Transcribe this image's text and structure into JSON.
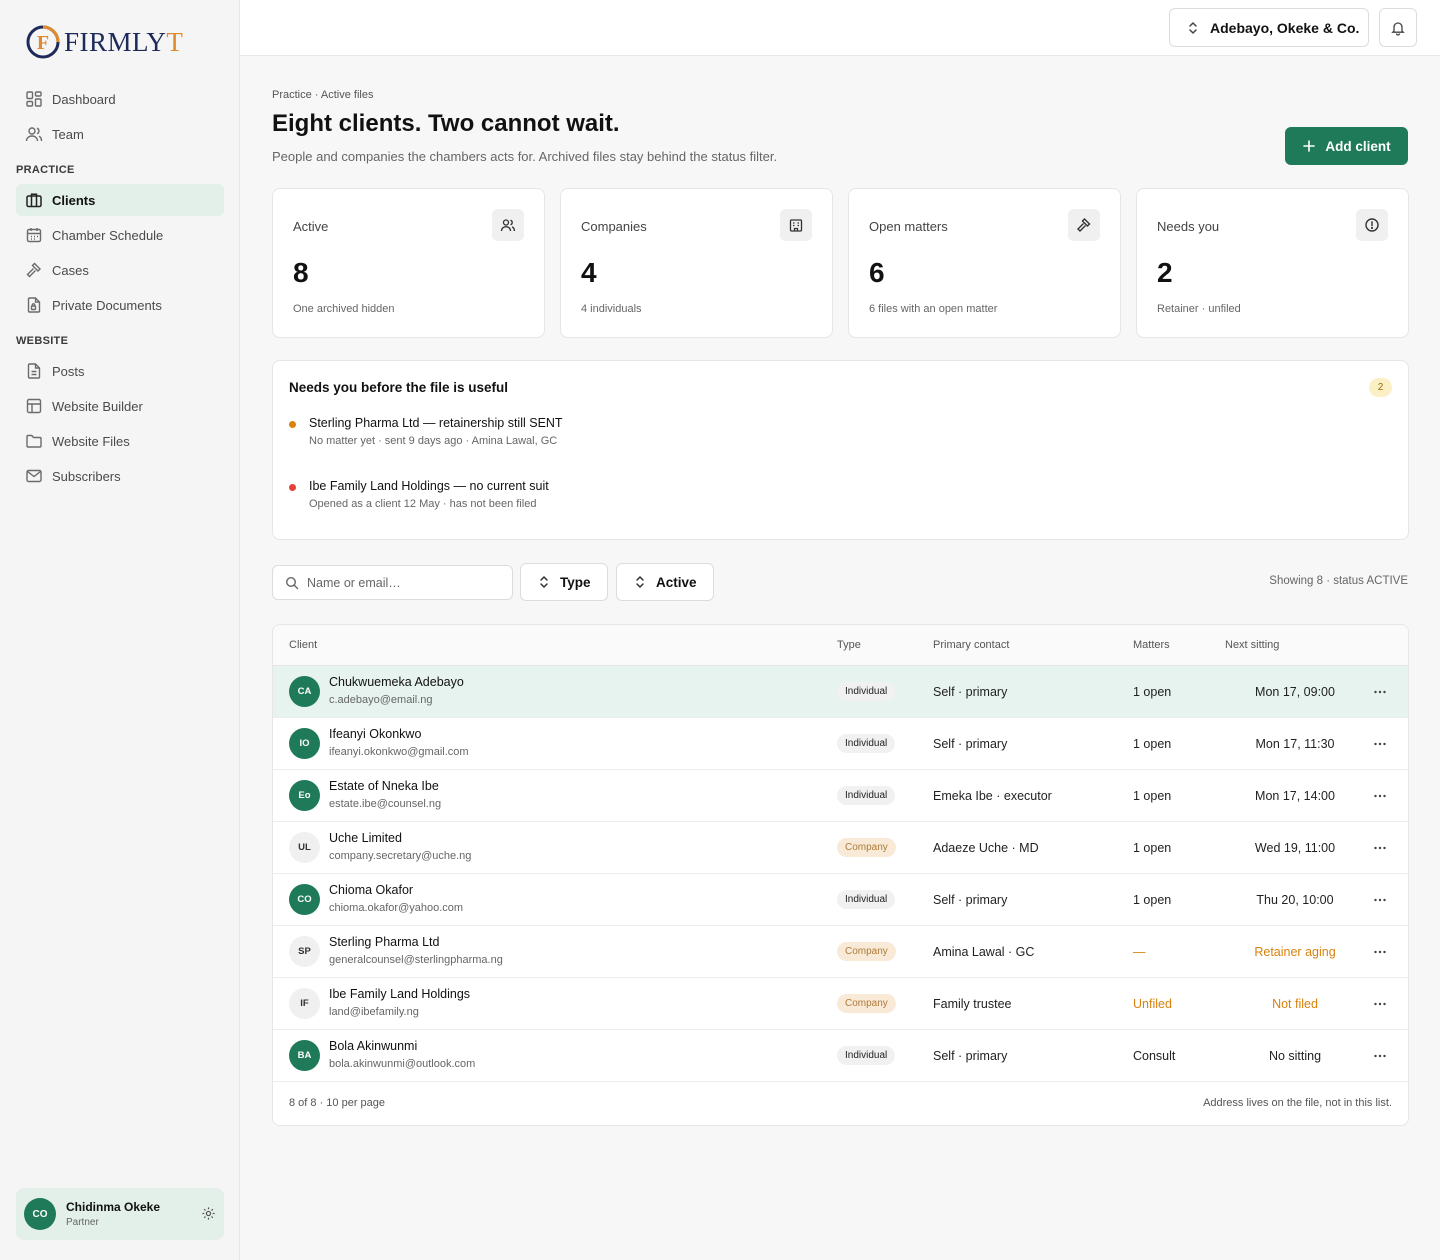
{
  "brand": {
    "logo_letter": "F",
    "name_main": "FIRMLY",
    "name_accent": "T"
  },
  "sidebar": {
    "items_top": [
      {
        "label": "Dashboard",
        "icon": "dashboard-icon"
      },
      {
        "label": "Team",
        "icon": "users-icon"
      }
    ],
    "section_practice": "PRACTICE",
    "items_practice": [
      {
        "label": "Clients",
        "icon": "briefcase-icon",
        "active": true
      },
      {
        "label": "Chamber Schedule",
        "icon": "calendar-icon"
      },
      {
        "label": "Cases",
        "icon": "gavel-icon"
      },
      {
        "label": "Private Documents",
        "icon": "lock-file-icon"
      }
    ],
    "section_website": "WEBSITE",
    "items_website": [
      {
        "label": "Posts",
        "icon": "document-icon"
      },
      {
        "label": "Website Builder",
        "icon": "layout-icon"
      },
      {
        "label": "Website Files",
        "icon": "folder-icon"
      },
      {
        "label": "Subscribers",
        "icon": "mail-icon"
      }
    ],
    "user": {
      "initials": "CO",
      "name": "Chidinma Okeke",
      "role": "Partner"
    }
  },
  "topbar": {
    "org_name": "Adebayo, Okeke & Co."
  },
  "header": {
    "breadcrumb": "Practice · Active files",
    "title": "Eight clients. Two cannot wait.",
    "subtitle": "People and companies the chambers acts for. Archived files stay behind the status filter.",
    "add_button": "Add client"
  },
  "stats": [
    {
      "label": "Active",
      "value": "8",
      "note": "One archived hidden",
      "icon": "users-icon"
    },
    {
      "label": "Companies",
      "value": "4",
      "note": "4 individuals",
      "icon": "building-icon"
    },
    {
      "label": "Open matters",
      "value": "6",
      "note": "6 files with an open matter",
      "icon": "gavel-icon"
    },
    {
      "label": "Needs you",
      "value": "2",
      "note": "Retainer · unfiled",
      "icon": "alert-circle-icon"
    }
  ],
  "needs": {
    "title": "Needs you before the file is useful",
    "count": "2",
    "items": [
      {
        "title": "Sterling Pharma Ltd — retainership still SENT",
        "sub": "No matter yet · sent 9 days ago · Amina Lawal, GC",
        "color": "#d9820d"
      },
      {
        "title": "Ibe Family Land Holdings — no current suit",
        "sub": "Opened as a client 12 May · has not been filed",
        "color": "#e5403a"
      }
    ]
  },
  "filters": {
    "search_placeholder": "Name or email…",
    "type_label": "Type",
    "status_label": "Active",
    "showing": "Showing 8 · status ACTIVE"
  },
  "table": {
    "headers": {
      "client": "Client",
      "type": "Type",
      "contact": "Primary contact",
      "matters": "Matters",
      "next": "Next sitting"
    },
    "rows": [
      {
        "initials": "CA",
        "name": "Chukwuemeka Adebayo",
        "email": "c.adebayo@email.ng",
        "type": "Individual",
        "contact": "Self · primary",
        "matters": "1 open",
        "next": "Mon 17, 09:00"
      },
      {
        "initials": "IO",
        "name": "Ifeanyi Okonkwo",
        "email": "ifeanyi.okonkwo@gmail.com",
        "type": "Individual",
        "contact": "Self · primary",
        "matters": "1 open",
        "next": "Mon 17, 11:30"
      },
      {
        "initials": "Eo",
        "name": "Estate of Nneka Ibe",
        "email": "estate.ibe@counsel.ng",
        "type": "Individual",
        "contact": "Emeka Ibe · executor",
        "matters": "1 open",
        "next": "Mon 17, 14:00"
      },
      {
        "initials": "UL",
        "name": "Uche Limited",
        "email": "company.secretary@uche.ng",
        "type": "Company",
        "contact": "Adaeze Uche · MD",
        "matters": "1 open",
        "next": "Wed 19, 11:00"
      },
      {
        "initials": "CO",
        "name": "Chioma Okafor",
        "email": "chioma.okafor@yahoo.com",
        "type": "Individual",
        "contact": "Self · primary",
        "matters": "1 open",
        "next": "Thu 20, 10:00"
      },
      {
        "initials": "SP",
        "name": "Sterling Pharma Ltd",
        "email": "generalcounsel@sterlingpharma.ng",
        "type": "Company",
        "contact": "Amina Lawal · GC",
        "matters": "—",
        "next": "Retainer aging"
      },
      {
        "initials": "IF",
        "name": "Ibe Family Land Holdings",
        "email": "land@ibefamily.ng",
        "type": "Company",
        "contact": "Family trustee",
        "matters": "Unfiled",
        "next": "Not filed"
      },
      {
        "initials": "BA",
        "name": "Bola Akinwunmi",
        "email": "bola.akinwunmi@outlook.com",
        "type": "Individual",
        "contact": "Self · primary",
        "matters": "Consult",
        "next": "No sitting"
      }
    ],
    "footer_left": "8 of 8 · 10 per page",
    "footer_right": "Address lives on the file, not in this list."
  },
  "colors": {
    "accent": "#1f7a5a",
    "warning": "#d9820d",
    "danger": "#e5403a"
  }
}
